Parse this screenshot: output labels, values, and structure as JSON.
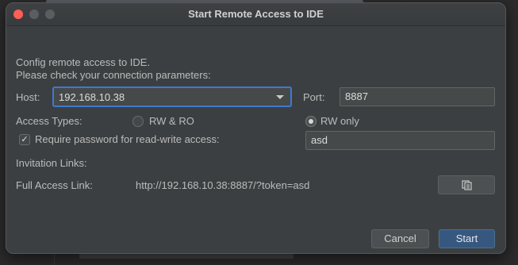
{
  "dialog": {
    "title": "Start Remote Access to IDE",
    "intro_line1": "Config remote access to IDE.",
    "intro_line2": "Please check your connection parameters:",
    "host_label": "Host:",
    "host_value": "192.168.10.38",
    "port_label": "Port:",
    "port_value": "8887",
    "access_types_label": "Access Types:",
    "access_options": [
      {
        "label": "RW & RO",
        "selected": false
      },
      {
        "label": "RW only",
        "selected": true
      }
    ],
    "require_password_label": "Require password for read-write access:",
    "require_password_checked": true,
    "password_value": "asd",
    "invitation_links_label": "Invitation Links:",
    "full_access_label": "Full Access Link:",
    "full_access_url": "http://192.168.10.38:8887/?token=asd",
    "copy_icon": "copy-icon",
    "cancel_label": "Cancel",
    "start_label": "Start"
  },
  "colors": {
    "window_bg": "#3c3f41",
    "primary_button": "#365880",
    "focus_border": "#3d7ad1",
    "close_button": "#ff5f57"
  }
}
